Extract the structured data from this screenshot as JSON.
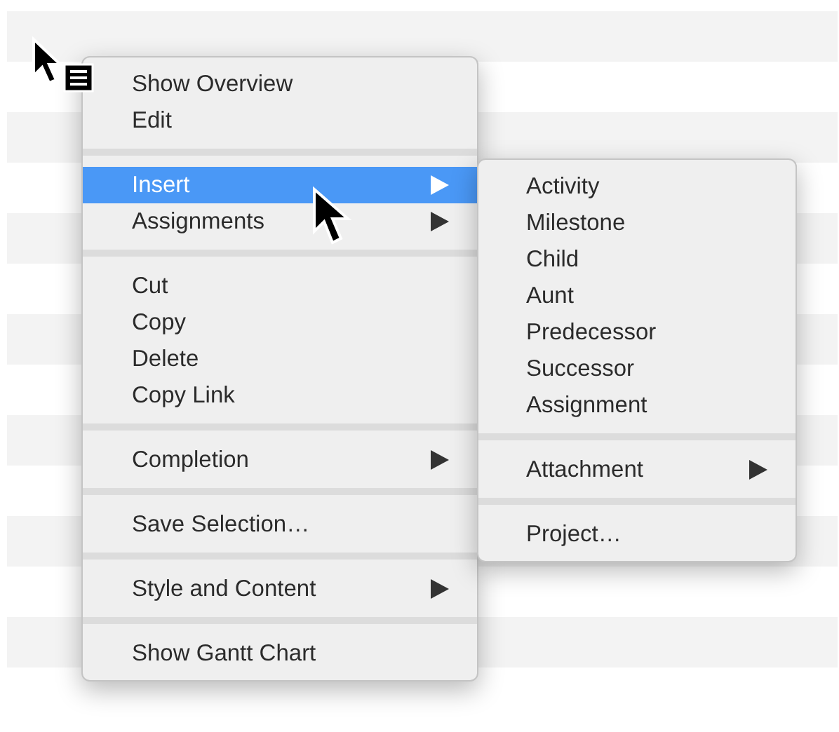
{
  "context_menu": {
    "groups": [
      [
        {
          "label": "Show Overview",
          "has_submenu": false,
          "selected": false
        },
        {
          "label": "Edit",
          "has_submenu": false,
          "selected": false
        }
      ],
      [
        {
          "label": "Insert",
          "has_submenu": true,
          "selected": true
        },
        {
          "label": "Assignments",
          "has_submenu": true,
          "selected": false
        }
      ],
      [
        {
          "label": "Cut",
          "has_submenu": false,
          "selected": false
        },
        {
          "label": "Copy",
          "has_submenu": false,
          "selected": false
        },
        {
          "label": "Delete",
          "has_submenu": false,
          "selected": false
        },
        {
          "label": "Copy Link",
          "has_submenu": false,
          "selected": false
        }
      ],
      [
        {
          "label": "Completion",
          "has_submenu": true,
          "selected": false
        }
      ],
      [
        {
          "label": "Save Selection…",
          "has_submenu": false,
          "selected": false
        }
      ],
      [
        {
          "label": "Style and Content",
          "has_submenu": true,
          "selected": false
        }
      ],
      [
        {
          "label": "Show Gantt Chart",
          "has_submenu": false,
          "selected": false
        }
      ]
    ]
  },
  "submenu": {
    "groups": [
      [
        {
          "label": "Activity",
          "has_submenu": false,
          "selected": false
        },
        {
          "label": "Milestone",
          "has_submenu": false,
          "selected": false
        },
        {
          "label": "Child",
          "has_submenu": false,
          "selected": false
        },
        {
          "label": "Aunt",
          "has_submenu": false,
          "selected": false
        },
        {
          "label": "Predecessor",
          "has_submenu": false,
          "selected": false
        },
        {
          "label": "Successor",
          "has_submenu": false,
          "selected": false
        },
        {
          "label": "Assignment",
          "has_submenu": false,
          "selected": false
        }
      ],
      [
        {
          "label": "Attachment",
          "has_submenu": true,
          "selected": false
        }
      ],
      [
        {
          "label": "Project…",
          "has_submenu": false,
          "selected": false
        }
      ]
    ]
  }
}
